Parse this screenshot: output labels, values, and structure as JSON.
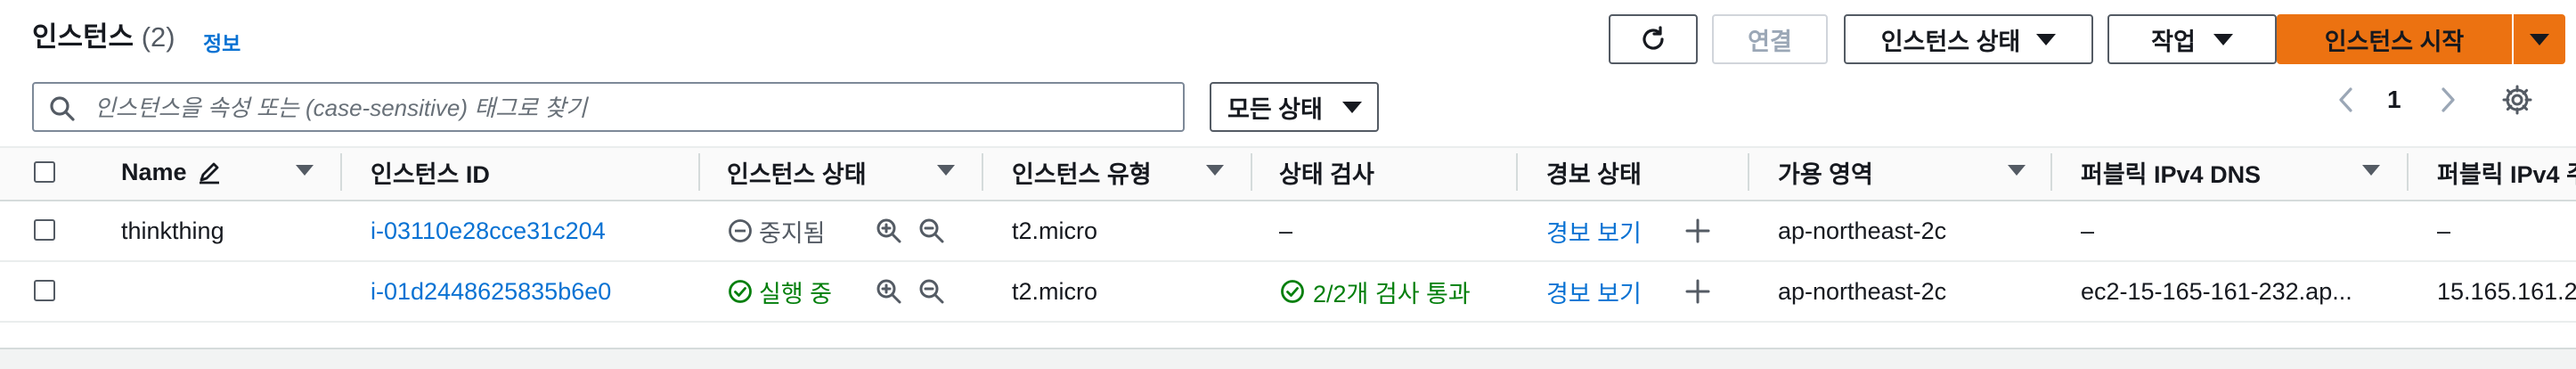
{
  "header": {
    "title": "인스턴스",
    "count": "(2)",
    "info_link": "정보"
  },
  "toolbar": {
    "connect_label": "연결",
    "instance_state_label": "인스턴스 상태",
    "actions_label": "작업",
    "launch_label": "인스턴스 시작"
  },
  "search": {
    "placeholder": "인스턴스을 속성 또는 (case-sensitive) 태그로 찾기",
    "state_filter": "모든 상태"
  },
  "pagination": {
    "current_page": "1"
  },
  "table": {
    "columns": [
      "Name",
      "인스턴스 ID",
      "인스턴스 상태",
      "인스턴스 유형",
      "상태 검사",
      "경보 상태",
      "가용 영역",
      "퍼블릭 IPv4 DNS",
      "퍼블릭 IPv4 주"
    ],
    "rows": [
      {
        "name": "thinkthing",
        "instance_id": "i-03110e28cce31c204",
        "state": "중지됨",
        "type": "t2.micro",
        "status_check": "–",
        "alarm": "경보 보기",
        "az": "ap-northeast-2c",
        "public_dns": "–",
        "public_ip": "–"
      },
      {
        "name": "",
        "instance_id": "i-01d2448625835b6e0",
        "state": "실행 중",
        "type": "t2.micro",
        "status_check": "2/2개 검사 통과",
        "alarm": "경보 보기",
        "az": "ap-northeast-2c",
        "public_dns": "ec2-15-165-161-232.ap...",
        "public_ip": "15.165.161.2"
      }
    ]
  },
  "colors": {
    "primary": "#ec7211",
    "link": "#0972d3",
    "success": "#037f0c",
    "muted": "#545b64"
  },
  "icons": [
    "refresh-icon",
    "caret-down-icon",
    "search-icon",
    "chevron-left-icon",
    "chevron-right-icon",
    "gear-icon",
    "edit-icon",
    "stopped-icon",
    "running-icon",
    "zoom-in-icon",
    "zoom-out-icon",
    "check-circle-icon",
    "plus-icon"
  ]
}
